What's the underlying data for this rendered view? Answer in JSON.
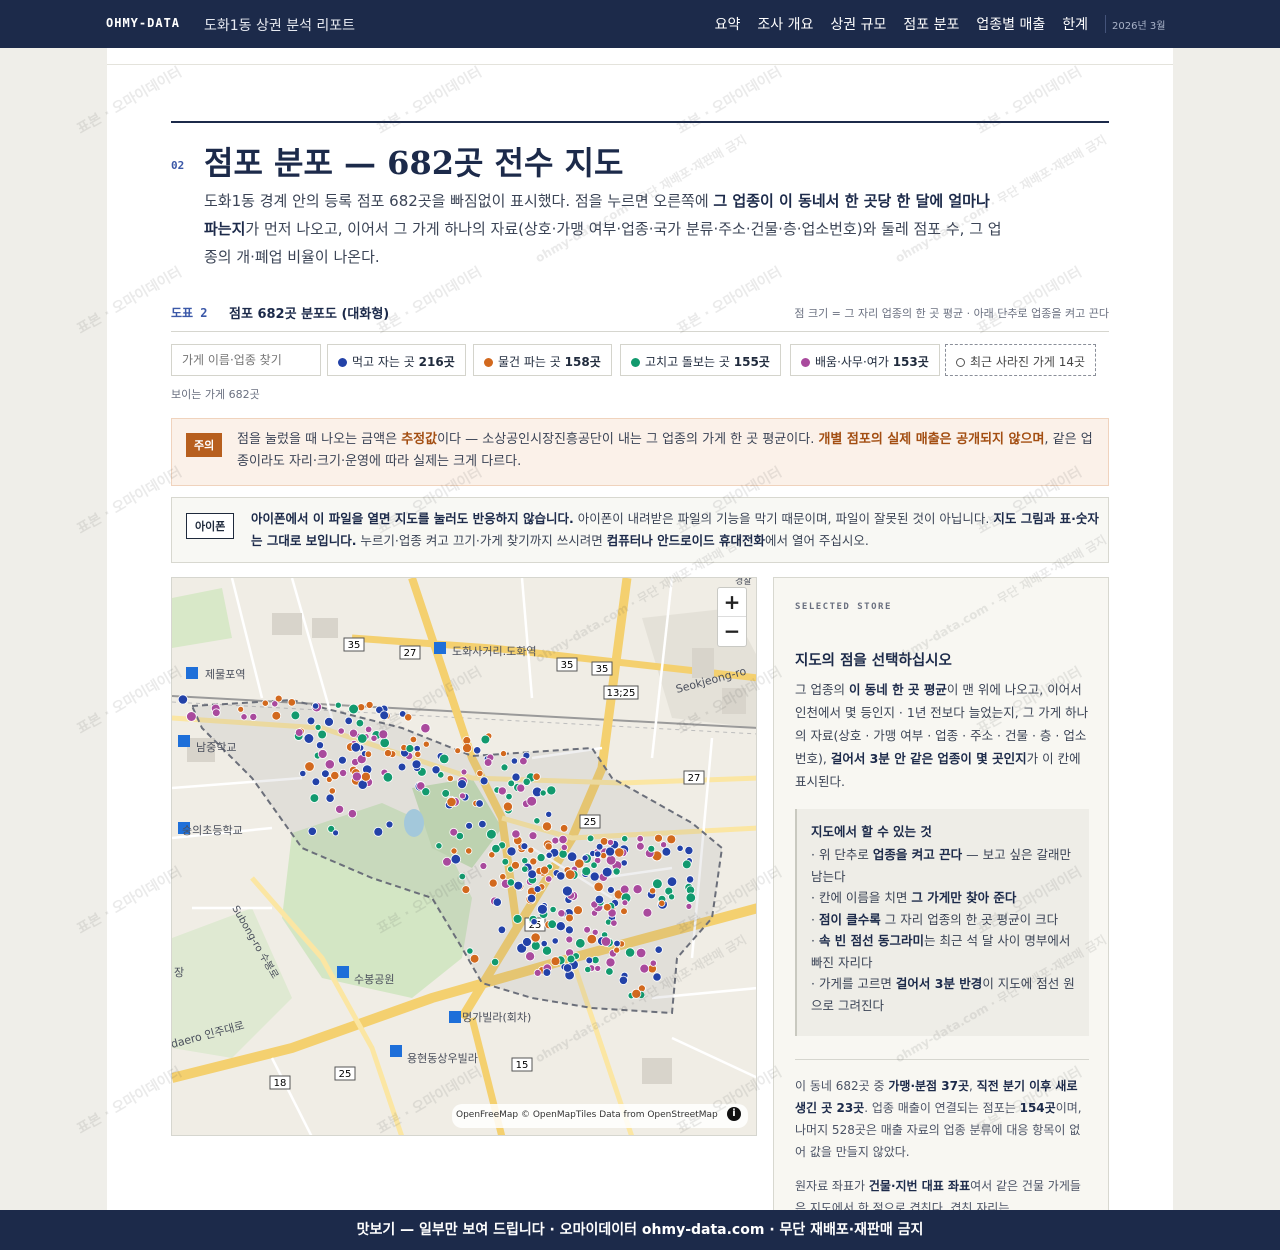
{
  "header": {
    "brand": "OHMY-DATA",
    "subtitle": "도화1동 상권 분석 리포트",
    "nav": [
      "요약",
      "조사 개요",
      "상권 규모",
      "점포 분포",
      "업종별 매출",
      "한계"
    ],
    "date": "2026년 3월"
  },
  "section": {
    "number": "02",
    "title": "점포 분포 — 682곳 전수 지도",
    "lede_1": "도화1동 경계 안의 등록 점포 682곳을 빠짐없이 표시했다. 점을 누르면 오른쪽에 ",
    "lede_bold": "그 업종이 이 동네서 한 곳당 한 달에 얼마나 파는지",
    "lede_2": "가 먼저 나오고, 이어서 그 가게 하나의 자료(상호·가맹 여부·업종·국가 분류·주소·건물·층·업소번호)와 둘레 점포 수, 그 업종의 개·폐업 비율이 나온다."
  },
  "figure": {
    "label": "도표 2",
    "title": "점포 682곳 분포도 (대화형)",
    "note": "점 크기 = 그 자리 업종의 한 곳 평균 · 아래 단추로 업종을 켜고 끈다"
  },
  "filters": {
    "search_placeholder": "가게 이름·업종 찾기",
    "chips": [
      {
        "label": "먹고 자는 곳",
        "count": "216곳",
        "color": "#2342a8"
      },
      {
        "label": "물건 파는 곳",
        "count": "158곳",
        "color": "#d2691e"
      },
      {
        "label": "고치고 돌보는 곳",
        "count": "155곳",
        "color": "#129a6e"
      },
      {
        "label": "배움·사무·여가",
        "count": "153곳",
        "color": "#a94a9d"
      }
    ],
    "closed_chip": "최근 사라진 가게 14곳",
    "visible_count": "보이는 가게 682곳"
  },
  "caution": {
    "badge": "주의",
    "t1": "점을 눌렀을 때 나오는 금액은 ",
    "b1": "추정값",
    "t2": "이다 — 소상공인시장진흥공단이 내는 그 업종의 가게 한 곳 평균이다. ",
    "b2": "개별 점포의 실제 매출은 공개되지 않으며",
    "t3": ", 같은 업종이라도 자리·크기·운영에 따라 실제는 크게 다르다."
  },
  "iphone": {
    "badge": "아이폰",
    "b1": "아이폰에서 이 파일을 열면 지도를 눌러도 반응하지 않습니다.",
    "t1": " 아이폰이 내려받은 파일의 기능을 막기 때문이며, 파일이 잘못된 것이 아닙니다. ",
    "b2": "지도 그림과 표·숫자는 그대로 보입니다.",
    "t2": " 누르기·업종 켜고 끄기·가게 찾기까지 쓰시려면 ",
    "b3": "컴퓨터나 안드로이드 휴대전화",
    "t3": "에서 열어 주십시오."
  },
  "map": {
    "zoom_in": "+",
    "zoom_out": "−",
    "attribution": "OpenFreeMap © OpenMapTiles Data from OpenStreetMap",
    "info": "i",
    "labels": [
      "제물포역",
      "남중학교",
      "숭의초등학교",
      "도화사거리.도화역",
      "Seokjeong-ro",
      "Subong-ro 수봉로",
      "수봉공원",
      "명가빌라(회차)",
      "용현동상우빌라",
      "daero 인주대로",
      "장",
      "경찰"
    ],
    "route_shields": [
      "35",
      "27",
      "35",
      "35",
      "13;25",
      "27",
      "25",
      "25",
      "15",
      "18",
      "25"
    ]
  },
  "panel": {
    "kicker": "SELECTED STORE",
    "title": "지도의 점을 선택하십시오",
    "d1": "그 업종의 ",
    "d_b1": "이 동네 한 곳 평균",
    "d2": "이 맨 위에 나오고, 이어서 인천에서 몇 등인지 · 1년 전보다 늘었는지, 그 가게 하나의 자료(상호 · 가맹 여부 · 업종 · 주소 · 건물 · 층 · 업소번호), ",
    "d_b2": "걸어서 3분 안 같은 업종이 몇 곳인지",
    "d3": "가 이 칸에 표시된다.",
    "box_title": "지도에서 할 수 있는 것",
    "box_items": [
      {
        "pre": "· 위 단추로 ",
        "bold": "업종을 켜고 끈다",
        "post": " — 보고 싶은 갈래만 남는다"
      },
      {
        "pre": "· 칸에 이름을 치면 ",
        "bold": "그 가게만 찾아 준다",
        "post": ""
      },
      {
        "pre": "· ",
        "bold": "점이 클수록",
        "post": " 그 자리 업종의 한 곳 평균이 크다"
      },
      {
        "pre": "· ",
        "bold": "속 빈 점선 동그라미",
        "post": "는 최근 석 달 사이 명부에서 빠진 자리다"
      },
      {
        "pre": "· 가게를 고르면 ",
        "bold": "걸어서 3분 반경",
        "post": "이 지도에 점선 원으로 그려진다"
      }
    ],
    "n1": "이 동네 682곳 중 ",
    "n_b1": "가맹·분점 37곳",
    "n2": ", ",
    "n_b2": "직전 분기 이후 새로 생긴 곳 23곳",
    "n3": ". 업종 매출이 연결되는 점포는 ",
    "n_b3": "154곳",
    "n4": "이며, 나머지 528곳은 매출 자료의 업종 분류에 대응 항목이 없어 값을 만들지 않았다.",
    "m1": "원자료 좌표가 ",
    "m_b1": "건물·지번 대표 좌표",
    "m2": "여서 같은 건물 가게들은 지도에서 한 점으로 겹친다. 겹친 자리는"
  },
  "footer": {
    "text": "맛보기 — 일부만 보여 드립니다 · 오마이데이터 ohmy-data.com · 무단 재배포·재판매 금지"
  },
  "watermark": "표본 · 오마이데이터",
  "watermark_url": "ohmy-data.com · 무단 재배포·재판매 금지"
}
